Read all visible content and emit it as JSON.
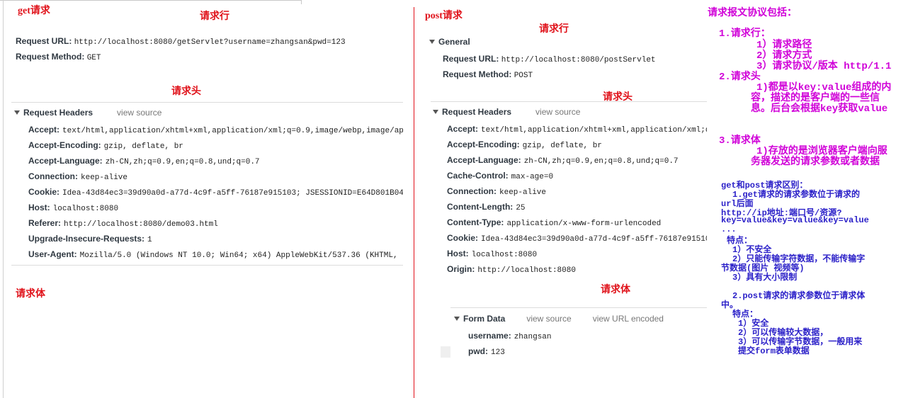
{
  "get_panel": {
    "title": "get请求",
    "label_line": "请求行",
    "request_url_key": "Request URL:",
    "request_url_val": "http://localhost:8080/getServlet?username=zhangsan&pwd=123",
    "request_method_key": "Request Method:",
    "request_method_val": "GET",
    "label_headers": "请求头",
    "headers_section": "Request Headers",
    "view_source": "view source",
    "headers": [
      {
        "k": "Accept:",
        "v": "text/html,application/xhtml+xml,application/xml;q=0.9,image/webp,image/ap"
      },
      {
        "k": "Accept-Encoding:",
        "v": "gzip, deflate, br"
      },
      {
        "k": "Accept-Language:",
        "v": "zh-CN,zh;q=0.9,en;q=0.8,und;q=0.7"
      },
      {
        "k": "Connection:",
        "v": "keep-alive"
      },
      {
        "k": "Cookie:",
        "v": "Idea-43d84ec3=39d90a0d-a77d-4c9f-a5ff-76187e915103; JSESSIONID=E64D801B04"
      },
      {
        "k": "Host:",
        "v": "localhost:8080"
      },
      {
        "k": "Referer:",
        "v": "http://localhost:8080/demo03.html"
      },
      {
        "k": "Upgrade-Insecure-Requests:",
        "v": "1"
      },
      {
        "k": "User-Agent:",
        "v": "Mozilla/5.0 (Windows NT 10.0; Win64; x64) AppleWebKit/537.36 (KHTML,"
      }
    ],
    "label_body": "请求体"
  },
  "post_panel": {
    "title": "post请求",
    "label_line": "请求行",
    "general_section": "General",
    "request_url_key": "Request URL:",
    "request_url_val": "http://localhost:8080/postServlet",
    "request_method_key": "Request Method:",
    "request_method_val": "POST",
    "label_headers": "请求头",
    "headers_section": "Request Headers",
    "view_source": "view source",
    "headers": [
      {
        "k": "Accept:",
        "v": "text/html,application/xhtml+xml,application/xml;q"
      },
      {
        "k": "Accept-Encoding:",
        "v": "gzip, deflate, br"
      },
      {
        "k": "Accept-Language:",
        "v": "zh-CN,zh;q=0.9,en;q=0.8,und;q=0.7"
      },
      {
        "k": "Cache-Control:",
        "v": "max-age=0"
      },
      {
        "k": "Connection:",
        "v": "keep-alive"
      },
      {
        "k": "Content-Length:",
        "v": "25"
      },
      {
        "k": "Content-Type:",
        "v": "application/x-www-form-urlencoded"
      },
      {
        "k": "Cookie:",
        "v": "Idea-43d84ec3=39d90a0d-a77d-4c9f-a5ff-76187e91510"
      },
      {
        "k": "Host:",
        "v": "localhost:8080"
      },
      {
        "k": "Origin:",
        "v": "http://localhost:8080"
      }
    ],
    "label_body": "请求体",
    "form_section": "Form Data",
    "form_view_source": "view source",
    "form_view_url": "view URL encoded",
    "form": [
      {
        "k": "username:",
        "v": "zhangsan"
      },
      {
        "k": "pwd:",
        "v": "123"
      }
    ]
  },
  "notes": {
    "heading": "请求报文协议包括：",
    "lines": [
      "1.请求行：",
      "1）请求路径",
      "2）请求方式",
      "3）请求协议/版本 http/1.1",
      "2.请求头",
      "1)都是以key:value组成的内",
      "容，描述的是客户端的一些信",
      "息。后台会根据key获取value",
      "3.请求体",
      "1)存放的是浏览器客户端向服",
      "务器发送的请求参数或者数据"
    ],
    "diff": [
      "get和post请求区别：",
      "1.get请求的请求参数位于请求的",
      "url后面",
      "http://ip地址:端口号/资源?",
      "key=value&key=value&key=value",
      "...",
      "特点：",
      "1）不安全",
      "2）只能传输字符数据，不能传输字",
      "节数据(图片 视频等)",
      "3）具有大小限制",
      "2.post请求的请求参数位于请求体",
      "中。",
      "特点：",
      "1）安全",
      "2）可以传输较大数据，",
      "3）可以传输字节数据，一般用来",
      "提交form表单数据"
    ]
  },
  "colors": {
    "red": "#e0121a",
    "purple": "#d000d8",
    "blue": "#2a1fc8",
    "divider": "#e0121a"
  }
}
